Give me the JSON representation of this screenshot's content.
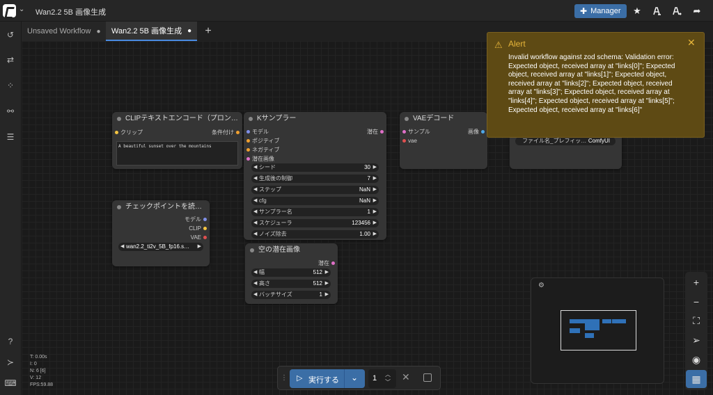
{
  "app": {
    "workflow_title": "Wan2.2 5B 画像生成",
    "manager_label": "Manager"
  },
  "tabs": [
    {
      "label": "Unsaved Workflow",
      "modified": "●"
    },
    {
      "label": "Wan2.2 5B 画像生成",
      "modified": "●"
    }
  ],
  "icons": {
    "logo": "comfyui-logo",
    "top_right": [
      "puzzle-icon",
      "star-icon",
      "workflow-template-icon",
      "model-library-icon",
      "share-icon"
    ],
    "sidebar": [
      "history-icon",
      "queue-icon",
      "nodes-library-icon",
      "model-library-icon",
      "templates-icon",
      "help-icon",
      "terminal-icon",
      "keyboard-icon"
    ]
  },
  "nodes": {
    "clip_encode": {
      "title": "CLIPテキストエンコード（プロン…",
      "input": "クリップ",
      "output": "条件付け",
      "text": "A beautiful sunset over the mountains"
    },
    "ksampler": {
      "title": "Kサンプラー",
      "inputs": [
        "モデル",
        "ポジティブ",
        "ネガティブ",
        "潜在画像"
      ],
      "output": "潜在",
      "widgets": [
        {
          "label": "シード",
          "value": "30"
        },
        {
          "label": "生成後の制御",
          "value": "7"
        },
        {
          "label": "ステップ",
          "value": "NaN"
        },
        {
          "label": "cfg",
          "value": "NaN"
        },
        {
          "label": "サンプラー名",
          "value": "1"
        },
        {
          "label": "スケジューラ",
          "value": "123456"
        },
        {
          "label": "ノイズ除去",
          "value": "1.00"
        }
      ]
    },
    "vae_decode": {
      "title": "VAEデコード",
      "inputs": [
        "サンプル",
        "vae"
      ],
      "output": "画像"
    },
    "save_image": {
      "widget_label": "ファイル名_プレフィッ…",
      "widget_value": "ComfyUI"
    },
    "checkpoint": {
      "title": "チェックポイントを読…",
      "outputs": [
        "モデル",
        "CLIP",
        "VAE"
      ],
      "ckpt_name": "wan2.2_ti2v_5B_fp16.s…"
    },
    "empty_latent": {
      "title": "空の潜在画像",
      "output": "潜在",
      "widgets": [
        {
          "label": "幅",
          "value": "512"
        },
        {
          "label": "高さ",
          "value": "512"
        },
        {
          "label": "バッチサイズ",
          "value": "1"
        }
      ]
    }
  },
  "colors": {
    "pin_yellow": "#f5c542",
    "pin_orange": "#f0a030",
    "pin_pink": "#e070c8",
    "pin_blue": "#8090e8",
    "pin_red": "#e05050",
    "pin_lightblue": "#4fa8e8",
    "accent_blue": "#3b6ea6",
    "alert_bg": "#5e4a14",
    "alert_text": "#e6b53a"
  },
  "alert": {
    "title": "Alert",
    "message": "Invalid workflow against zod schema: Validation error: Expected object, received array at \"links[0]\"; Expected object, received array at \"links[1]\"; Expected object, received array at \"links[2]\"; Expected object, received array at \"links[3]\"; Expected object, received array at \"links[4]\"; Expected object, received array at \"links[5]\"; Expected object, received array at \"links[6]\""
  },
  "stats": {
    "t": "T: 0.00s",
    "i": "I: 0",
    "n": "N: 6 [6]",
    "v": "V: 12",
    "fps": "FPS:59.88"
  },
  "runbar": {
    "run_label": "実行する",
    "queue_count": "1"
  }
}
